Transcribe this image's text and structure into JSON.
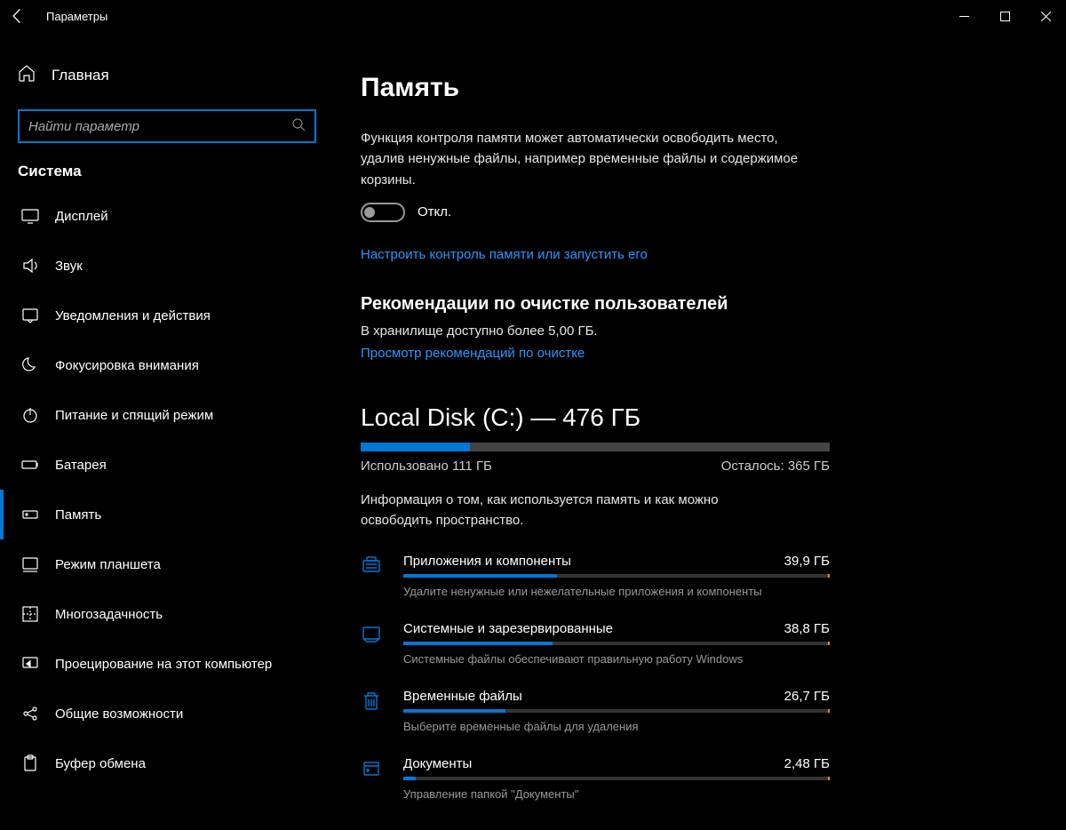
{
  "window": {
    "title": "Параметры"
  },
  "sidebar": {
    "home": "Главная",
    "search_placeholder": "Найти параметр",
    "section": "Система",
    "items": [
      {
        "label": "Дисплей",
        "icon": "display"
      },
      {
        "label": "Звук",
        "icon": "sound"
      },
      {
        "label": "Уведомления и действия",
        "icon": "notify"
      },
      {
        "label": "Фокусировка внимания",
        "icon": "moon"
      },
      {
        "label": "Питание и спящий режим",
        "icon": "power"
      },
      {
        "label": "Батарея",
        "icon": "battery"
      },
      {
        "label": "Память",
        "icon": "storage",
        "active": true
      },
      {
        "label": "Режим планшета",
        "icon": "tablet"
      },
      {
        "label": "Многозадачность",
        "icon": "multitask"
      },
      {
        "label": "Проецирование на этот компьютер",
        "icon": "project"
      },
      {
        "label": "Общие возможности",
        "icon": "shared"
      },
      {
        "label": "Буфер обмена",
        "icon": "clipboard"
      }
    ]
  },
  "main": {
    "title": "Память",
    "storage_sense_desc": "Функция контроля памяти может автоматически освободить место, удалив ненужные файлы, например временные файлы и содержимое корзины.",
    "toggle_state": "Откл.",
    "configure_link": "Настроить контроль памяти или запустить его",
    "recommend_heading": "Рекомендации по очистке пользователей",
    "recommend_sub": "В хранилище доступно более 5,00 ГБ.",
    "recommend_link": "Просмотр рекомендаций по очистке",
    "disk_title": "Local Disk (C:) — 476 ГБ",
    "disk_fill_pct": 23.3,
    "disk_used": "Использовано 111 ГБ",
    "disk_free": "Осталось: 365 ГБ",
    "usage_desc": "Информация о том, как используется память и как можно освободить пространство.",
    "categories": [
      {
        "icon": "apps",
        "name": "Приложения и компоненты",
        "size": "39,9 ГБ",
        "pct": 36,
        "hint": "Удалите ненужные или нежелательные приложения и компоненты"
      },
      {
        "icon": "system",
        "name": "Системные и зарезервированные",
        "size": "38,8 ГБ",
        "pct": 35,
        "hint": "Системные файлы обеспечивают правильную работу Windows"
      },
      {
        "icon": "trash",
        "name": "Временные файлы",
        "size": "26,7 ГБ",
        "pct": 24,
        "hint": "Выберите временные файлы для удаления"
      },
      {
        "icon": "docs",
        "name": "Документы",
        "size": "2,48 ГБ",
        "pct": 3,
        "hint": "Управление папкой \"Документы\""
      }
    ]
  }
}
